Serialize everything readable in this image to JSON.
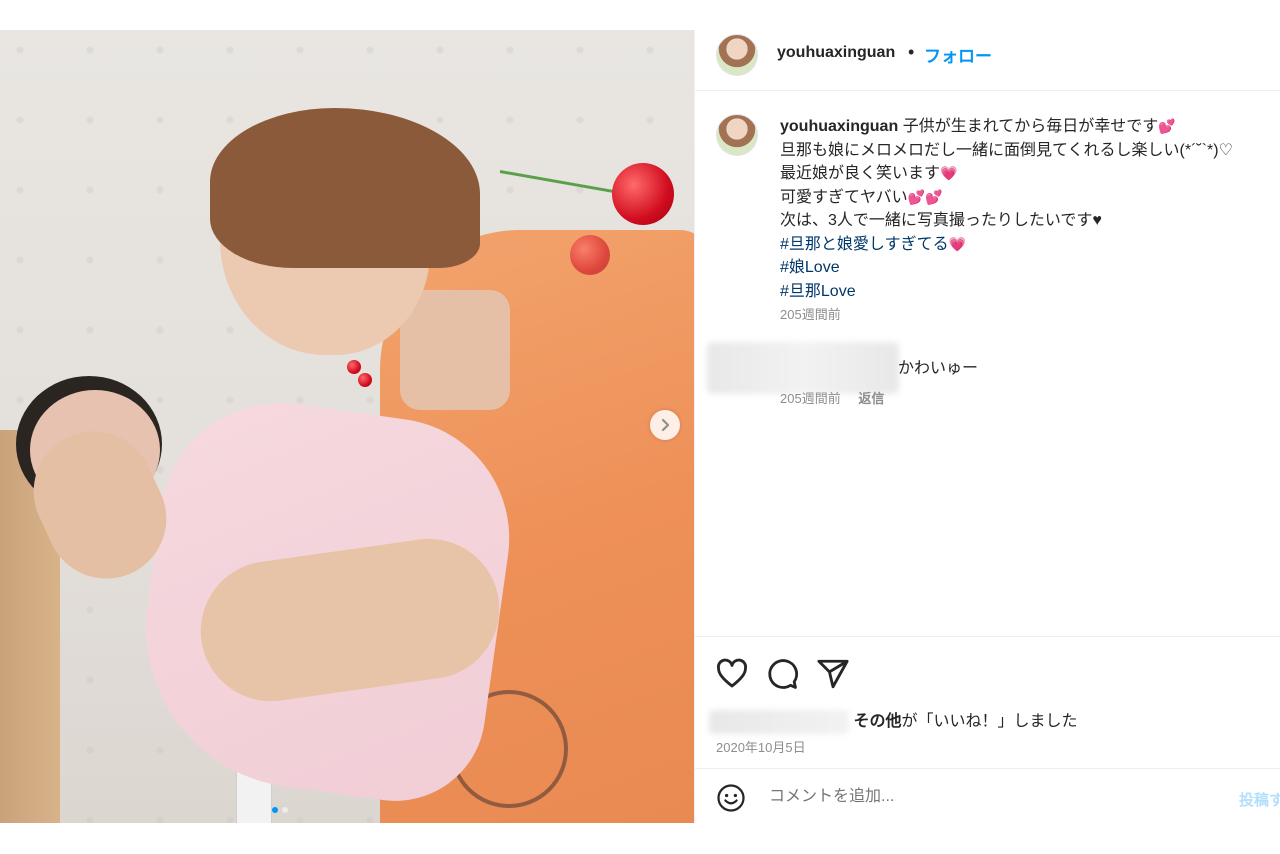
{
  "post": {
    "username": "youhuaxinguan",
    "separator": "•",
    "follow_label": "フォロー"
  },
  "caption": {
    "username": "youhuaxinguan",
    "line1": "子供が生まれてから毎日が幸せです",
    "line2": "旦那も娘にメロメロだし一緒に面倒見てくれるし楽しい(*´˘`*)♡",
    "line3": "最近娘が良く笑います",
    "line4": "可愛すぎてヤバい",
    "line5": "次は、3人で一緒に写真撮ったりしたいです♥",
    "hashtags": [
      "#旦那と娘愛しすぎてる",
      "#娘Love",
      "#旦那Love"
    ],
    "time": "205週間前"
  },
  "comment": {
    "text": "かわいゅー",
    "time": "205週間前",
    "reply_label": "返信"
  },
  "likes": {
    "other_label": "その他",
    "suffix": "が「いいね！」しました"
  },
  "date": "2020年10月5日",
  "comment_input": {
    "placeholder": "コメントを追加...",
    "post_label": "投稿する"
  },
  "icons": [
    "next-arrow-icon",
    "heart-icon",
    "comment-icon",
    "share-icon",
    "emoji-icon"
  ],
  "carousel": {
    "total": 2,
    "active": 0
  },
  "colors": {
    "link": "#0095f6",
    "hashtag": "#00376b",
    "secondary": "#8e8e8e",
    "post_disabled": "#b2dffc"
  }
}
